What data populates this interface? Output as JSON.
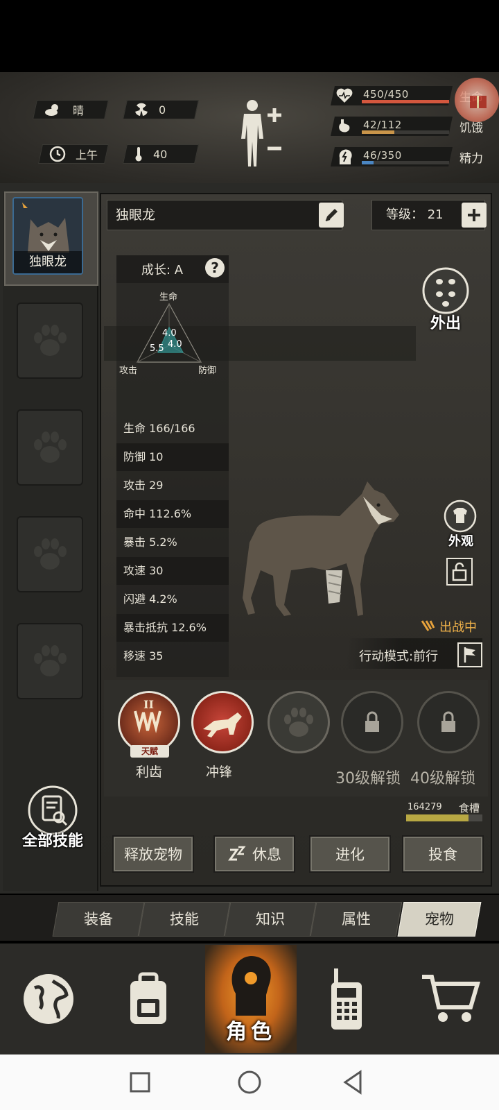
{
  "header": {
    "weather": "晴",
    "radiation": "0",
    "time_of_day": "上午",
    "temperature": "40",
    "stats": [
      {
        "value": "450/450",
        "label": "生命",
        "fill": 1.0,
        "color": "#d4573e",
        "icon": "heart-pulse-icon"
      },
      {
        "value": "42/112",
        "label": "饥饿",
        "fill": 0.375,
        "color": "#c9954a",
        "icon": "stomach-icon"
      },
      {
        "value": "46/350",
        "label": "精力",
        "fill": 0.131,
        "color": "#4b86c2",
        "icon": "energy-head-icon"
      }
    ]
  },
  "pet": {
    "name": "独眼龙",
    "card_name": "独眼龙",
    "level_text": "等级： 21",
    "growth_text": "成长: A",
    "radar": {
      "top_label": "生命",
      "left_label": "攻击",
      "right_label": "防御",
      "v_top": "4.0",
      "v_left": "5.5",
      "v_right": "4.0"
    },
    "stats": [
      "生命 166/166",
      "防御 10",
      "攻击 29",
      "命中 112.6%",
      "暴击 5.2%",
      "攻速 30",
      "闪避 4.2%",
      "暴击抵抗 12.6%",
      "移速 35"
    ],
    "out_label": "外出",
    "appearance_label": "外观",
    "battle_status": "出战中",
    "action_mode": "行动模式:前行"
  },
  "skills": {
    "items": [
      {
        "label": "利齿",
        "badge": "天赋",
        "tier": "II"
      },
      {
        "label": "冲锋"
      }
    ],
    "lock_30": "30级解锁",
    "lock_40": "40级解锁",
    "all_skills": "全部技能"
  },
  "food": {
    "amount": "164279",
    "label": "食槽",
    "fill": 0.82
  },
  "actions": {
    "release": "释放宠物",
    "rest": "休息",
    "evolve": "进化",
    "feed": "投食"
  },
  "tabs": [
    "装备",
    "技能",
    "知识",
    "属性",
    "宠物"
  ],
  "nav": {
    "active_label": "角色"
  }
}
